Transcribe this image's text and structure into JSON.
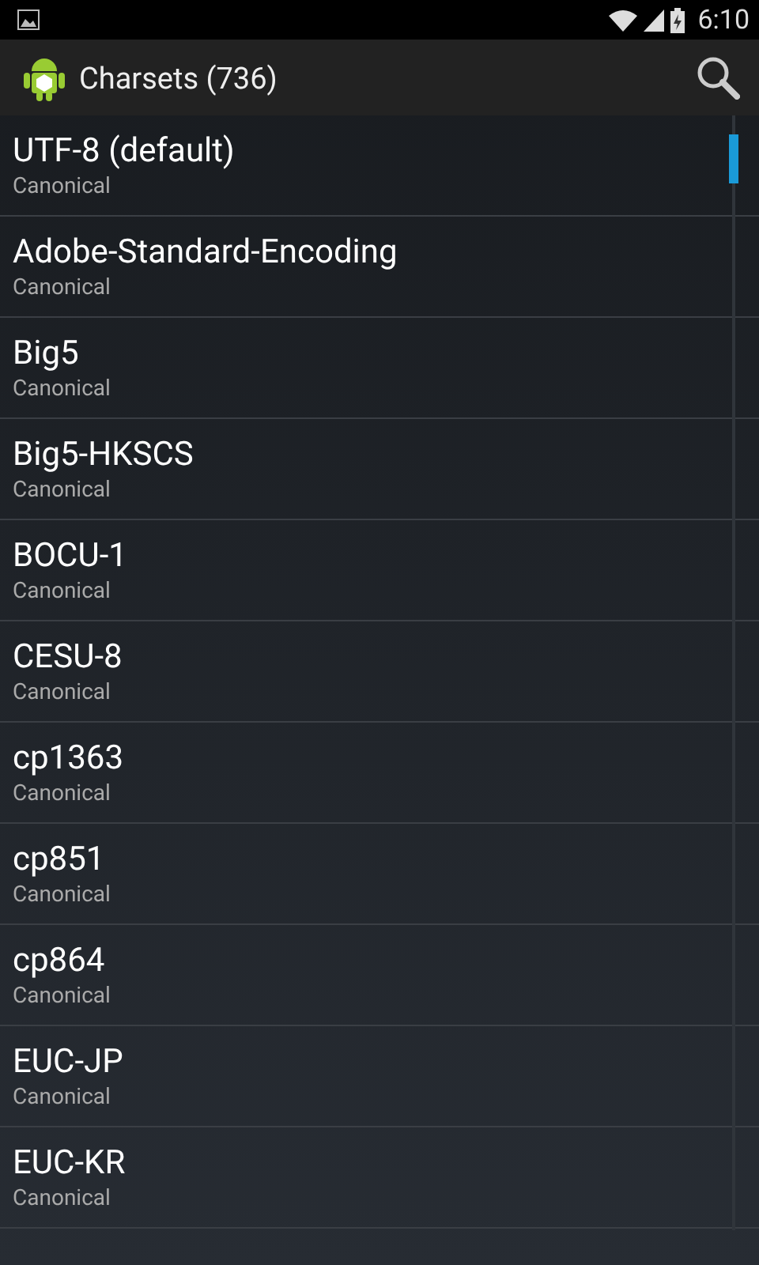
{
  "status_bar": {
    "time": "6:10"
  },
  "action_bar": {
    "title": "Charsets (736)"
  },
  "charsets": [
    {
      "name": "UTF-8 (default)",
      "type": "Canonical"
    },
    {
      "name": "Adobe-Standard-Encoding",
      "type": "Canonical"
    },
    {
      "name": "Big5",
      "type": "Canonical"
    },
    {
      "name": "Big5-HKSCS",
      "type": "Canonical"
    },
    {
      "name": "BOCU-1",
      "type": "Canonical"
    },
    {
      "name": "CESU-8",
      "type": "Canonical"
    },
    {
      "name": "cp1363",
      "type": "Canonical"
    },
    {
      "name": "cp851",
      "type": "Canonical"
    },
    {
      "name": "cp864",
      "type": "Canonical"
    },
    {
      "name": "EUC-JP",
      "type": "Canonical"
    },
    {
      "name": "EUC-KR",
      "type": "Canonical"
    }
  ]
}
